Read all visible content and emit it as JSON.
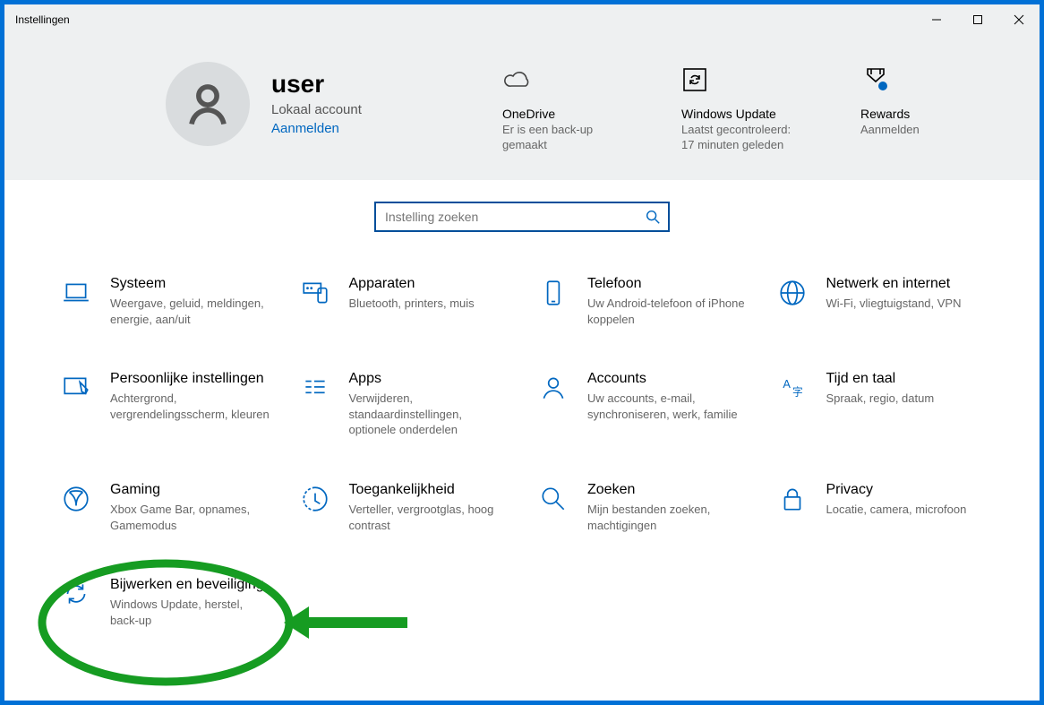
{
  "window": {
    "title": "Instellingen"
  },
  "user": {
    "name": "user",
    "accountType": "Lokaal account",
    "signInLabel": "Aanmelden"
  },
  "statusTiles": [
    {
      "id": "onedrive",
      "title": "OneDrive",
      "desc": "Er is een back-up gemaakt"
    },
    {
      "id": "windows-update",
      "title": "Windows Update",
      "desc": "Laatst gecontroleerd: 17 minuten geleden"
    },
    {
      "id": "rewards",
      "title": "Rewards",
      "desc": "Aanmelden"
    }
  ],
  "search": {
    "placeholder": "Instelling zoeken"
  },
  "categories": [
    {
      "id": "system",
      "title": "Systeem",
      "desc": "Weergave, geluid, meldingen, energie, aan/uit"
    },
    {
      "id": "devices",
      "title": "Apparaten",
      "desc": "Bluetooth, printers, muis"
    },
    {
      "id": "phone",
      "title": "Telefoon",
      "desc": "Uw Android-telefoon of iPhone koppelen"
    },
    {
      "id": "network",
      "title": "Netwerk en internet",
      "desc": "Wi-Fi, vliegtuigstand, VPN"
    },
    {
      "id": "personalization",
      "title": "Persoonlijke instellingen",
      "desc": "Achtergrond, vergrendelingsscherm, kleuren"
    },
    {
      "id": "apps",
      "title": "Apps",
      "desc": "Verwijderen, standaardinstellingen, optionele onderdelen"
    },
    {
      "id": "accounts",
      "title": "Accounts",
      "desc": "Uw accounts, e-mail, synchroniseren, werk, familie"
    },
    {
      "id": "time-language",
      "title": "Tijd en taal",
      "desc": "Spraak, regio, datum"
    },
    {
      "id": "gaming",
      "title": "Gaming",
      "desc": "Xbox Game Bar, opnames, Gamemodus"
    },
    {
      "id": "ease-of-access",
      "title": "Toegankelijkheid",
      "desc": "Verteller, vergrootglas, hoog contrast"
    },
    {
      "id": "search",
      "title": "Zoeken",
      "desc": "Mijn bestanden zoeken, machtigingen"
    },
    {
      "id": "privacy",
      "title": "Privacy",
      "desc": "Locatie, camera, microfoon"
    },
    {
      "id": "update-security",
      "title": "Bijwerken en beveiliging",
      "desc": "Windows Update, herstel, back-up"
    }
  ],
  "annotation": {
    "highlightCategory": "update-security",
    "color": "#169c22"
  }
}
